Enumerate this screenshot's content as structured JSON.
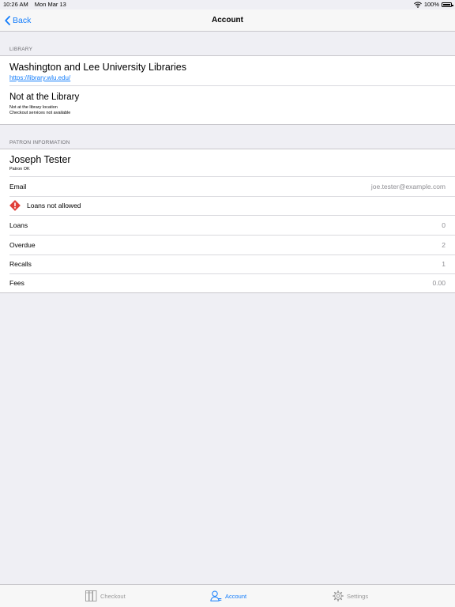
{
  "status_bar": {
    "time": "10:26 AM",
    "date": "Mon Mar 13",
    "battery": "100%",
    "wifi_icon": "wifi-icon",
    "battery_icon": "battery-icon"
  },
  "navbar": {
    "back_label": "Back",
    "title": "Account",
    "back_icon": "chevron-left-icon"
  },
  "library": {
    "section_title": "LIBRARY",
    "name": "Washington and Lee University Libraries",
    "url": "https://library.wlu.edu/",
    "location_title": "Not at the Library",
    "location_line1": "Not at the library location",
    "location_line2": "Checkout services not available"
  },
  "patron": {
    "section_title": "PATRON INFORMATION",
    "name": "Joseph Tester",
    "status": "Patron OK",
    "email_label": "Email",
    "email_value": "joe.tester@example.com",
    "warning_label": "Loans not allowed",
    "warning_icon": "warning-icon",
    "warning_color": "#e0403a",
    "rows": [
      {
        "label": "Loans",
        "value": "0"
      },
      {
        "label": "Overdue",
        "value": "2"
      },
      {
        "label": "Recalls",
        "value": "1"
      },
      {
        "label": "Fees",
        "value": "0.00"
      }
    ]
  },
  "tabbar": {
    "tabs": [
      {
        "label": "Checkout",
        "icon": "books-icon",
        "active": false
      },
      {
        "label": "Account",
        "icon": "person-icon",
        "active": true
      },
      {
        "label": "Settings",
        "icon": "gear-icon",
        "active": false
      }
    ]
  },
  "colors": {
    "accent": "#157efb",
    "background": "#efeff4",
    "separator": "#c8c7cc"
  }
}
